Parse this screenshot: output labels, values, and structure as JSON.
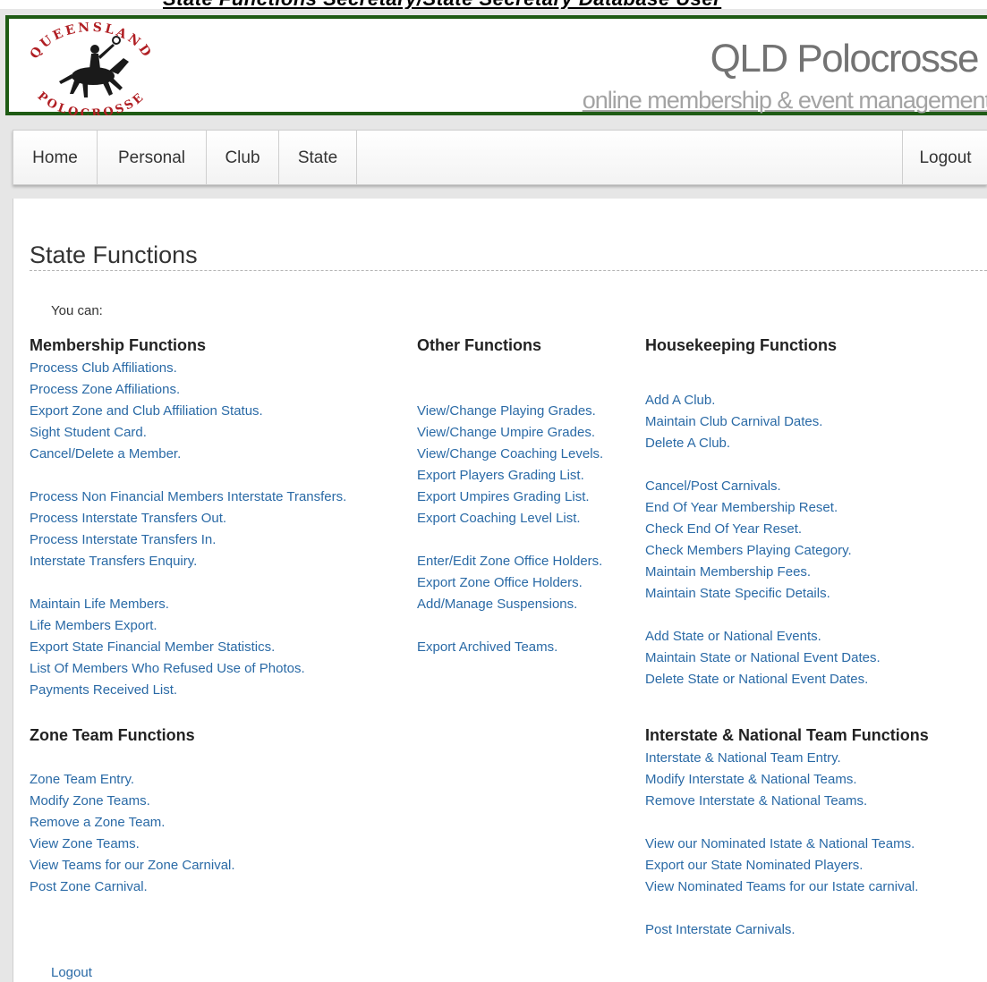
{
  "caption": "State Functions Secretary/State Secretary Database User",
  "header": {
    "logo_text_top": "QUEENSLAND",
    "logo_text_bottom": "POLOCROSSE",
    "title": "QLD Polocrosse",
    "tagline": "online membership & event management"
  },
  "nav": {
    "home": "Home",
    "personal": "Personal",
    "club": "Club",
    "state": "State",
    "logout": "Logout"
  },
  "page": {
    "title": "State Functions",
    "intro": "You can:"
  },
  "membership": {
    "heading": "Membership Functions",
    "links": [
      "Process Club Affiliations.",
      "Process Zone Affiliations.",
      "Export Zone and Club Affiliation Status.",
      "Sight Student Card.",
      "Cancel/Delete a Member.",
      "Process Non Financial Members Interstate Transfers.",
      "Process Interstate Transfers Out.",
      "Process Interstate Transfers In.",
      "Interstate Transfers Enquiry.",
      "Maintain Life Members.",
      "Life Members Export.",
      "Export State Financial Member Statistics.",
      "List Of Members Who Refused Use of Photos.",
      "Payments Received List."
    ]
  },
  "zone_team": {
    "heading": "Zone Team Functions",
    "links": [
      "Zone Team Entry.",
      "Modify Zone Teams.",
      "Remove a Zone Team.",
      "View Zone Teams.",
      "View Teams for our Zone Carnival.",
      "Post Zone Carnival."
    ]
  },
  "other": {
    "heading": "Other Functions",
    "links": [
      "View/Change Playing Grades.",
      "View/Change Umpire Grades.",
      "View/Change Coaching Levels.",
      "Export Players Grading List.",
      "Export Umpires Grading List.",
      "Export Coaching Level List.",
      "Enter/Edit Zone Office Holders.",
      "Export Zone Office Holders.",
      "Add/Manage Suspensions.",
      "Export Archived Teams."
    ]
  },
  "housekeeping": {
    "heading": "Housekeeping Functions",
    "links": [
      "Add A Club.",
      "Maintain Club Carnival Dates.",
      "Delete A Club.",
      "Cancel/Post Carnivals.",
      "End Of Year Membership Reset.",
      "Check End Of Year Reset.",
      "Check Members Playing Category.",
      "Maintain Membership Fees.",
      "Maintain State Specific Details.",
      "Add State or National Events.",
      "Maintain State or National Event Dates.",
      "Delete State or National Event Dates."
    ]
  },
  "interstate": {
    "heading": "Interstate & National Team Functions",
    "links": [
      "Interstate & National Team Entry.",
      "Modify Interstate & National Teams.",
      "Remove Interstate & National Teams.",
      "View our Nominated Istate & National Teams.",
      "Export our State Nominated Players.",
      "View Nominated Teams for our Istate carnival.",
      "Post Interstate Carnivals."
    ]
  },
  "footer": {
    "logout": "Logout"
  },
  "colors": {
    "header_border": "#1e5b14",
    "link": "#2a6aa6",
    "title": "#737373",
    "logo_red": "#b01e23"
  }
}
